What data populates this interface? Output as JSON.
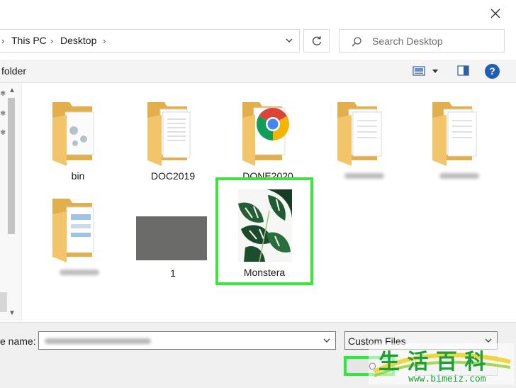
{
  "address": {
    "crumbs": [
      "This PC",
      "Desktop"
    ],
    "search_placeholder": "Search Desktop"
  },
  "toolbar": {
    "new_folder_label": "folder",
    "help_label": "?"
  },
  "items": [
    {
      "label": "bin"
    },
    {
      "label": "DOC2019"
    },
    {
      "label": "DONE2020"
    },
    {
      "label": "1"
    },
    {
      "label": "Monstera"
    }
  ],
  "footer": {
    "file_name_label": "e name:",
    "file_type_value": "Custom Files",
    "open_label": "O"
  },
  "watermark": {
    "site": "www.bimeiz.com",
    "characters": "生活百科"
  },
  "colors": {
    "highlight": "#39e63a",
    "folder": "#f2c56b",
    "folder_dark": "#e3ae4c",
    "help": "#1f5fb5"
  }
}
